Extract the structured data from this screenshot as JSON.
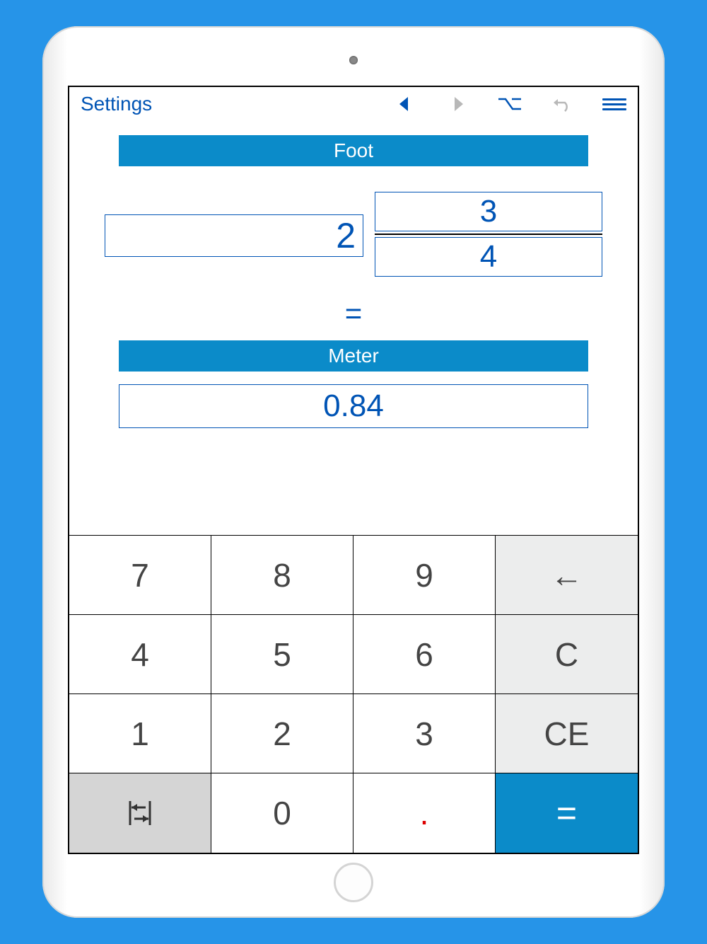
{
  "header": {
    "settings": "Settings"
  },
  "conversion": {
    "from_unit": "Foot",
    "to_unit": "Meter",
    "whole": "2",
    "numerator": "3",
    "denominator": "4",
    "equals": "=",
    "result": "0.84"
  },
  "keypad": {
    "k7": "7",
    "k8": "8",
    "k9": "9",
    "back": "←",
    "k4": "4",
    "k5": "5",
    "k6": "6",
    "clear": "C",
    "k1": "1",
    "k2": "2",
    "k3": "3",
    "ce": "CE",
    "k0": "0",
    "dot": ".",
    "eq": "="
  }
}
